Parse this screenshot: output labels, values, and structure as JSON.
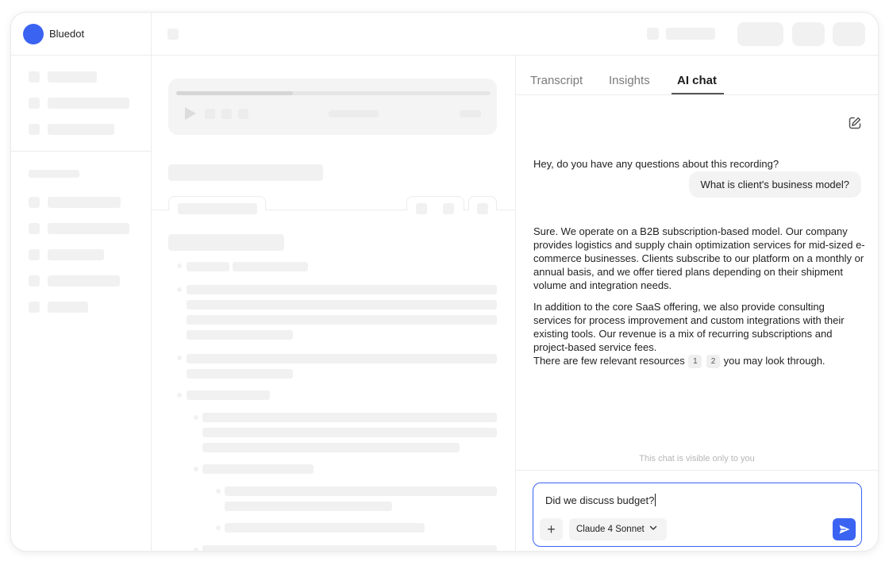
{
  "app": {
    "name": "Bluedot",
    "brand_color": "#3b63f2"
  },
  "player": {
    "progress": 0.37
  },
  "chat_panel": {
    "tabs": [
      {
        "label": "Transcript",
        "active": false
      },
      {
        "label": "Insights",
        "active": false
      },
      {
        "label": "AI chat",
        "active": true
      }
    ],
    "edit_icon": "new-chat-edit-icon",
    "messages": {
      "greeting": "Hey, do you have any questions about this recording?",
      "user_question": "What is client's business model?",
      "answer_p1": "Sure. We operate on a B2B subscription-based model. Our company provides logistics and supply chain optimization services for mid-sized e-commerce businesses. Clients subscribe to our platform on a monthly or annual basis, and we offer tiered plans depending on their shipment volume and integration needs.",
      "answer_p2": "In addition to the core SaaS offering, we also provide consulting services for process improvement and custom integrations with their existing tools. Our revenue is a mix of recurring subscriptions and project-based service fees.",
      "answer_p3_before": "There are few relevant resources",
      "answer_p3_after": "you may look through.",
      "refs": [
        "1",
        "2"
      ]
    },
    "visibility_note": "This chat is visible only to you",
    "composer": {
      "input_value": "Did we discuss budget?",
      "plus_label": "+",
      "model": "Claude 4 Sonnet",
      "send_icon": "send-icon"
    }
  }
}
